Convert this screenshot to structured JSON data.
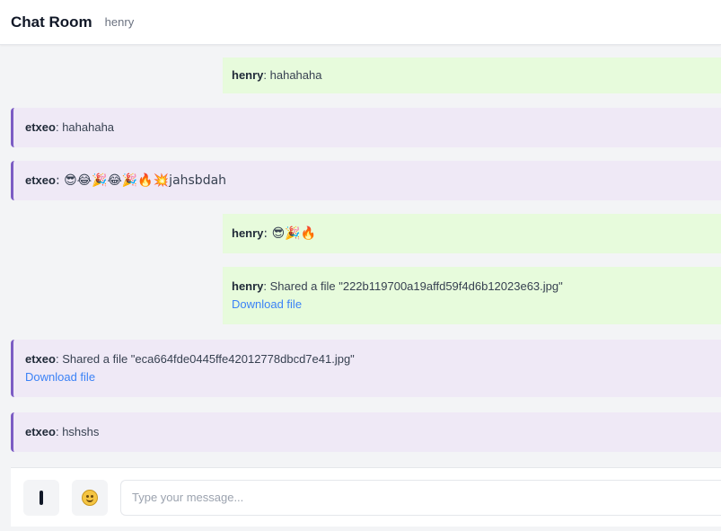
{
  "header": {
    "title": "Chat Room",
    "username": "henry"
  },
  "messages": [
    {
      "sender": "henry",
      "text": ": hahahaha"
    },
    {
      "sender": "etxeo",
      "text": ": hahahaha"
    },
    {
      "sender": "etxeo",
      "text": ": 😎😂🎉😂🎉🔥💥jahsbdah"
    },
    {
      "sender": "henry",
      "text": ": 😎🎉🔥"
    },
    {
      "sender": "henry",
      "text": ": Shared a file \"222b119700a19affd59f4d6b12023e63.jpg\"",
      "link": "Download file"
    },
    {
      "sender": "etxeo",
      "text": ": Shared a file \"eca664fde0445ffe42012778dbcd7e41.jpg\"",
      "link": "Download file"
    },
    {
      "sender": "etxeo",
      "text": ": hshshs"
    }
  ],
  "composer": {
    "placeholder": "Type your message..."
  },
  "colors": {
    "self_bubble": "#e7fbdc",
    "other_bubble": "#efe9f6",
    "accent": "#7c5cc4",
    "link": "#3b82f6"
  }
}
